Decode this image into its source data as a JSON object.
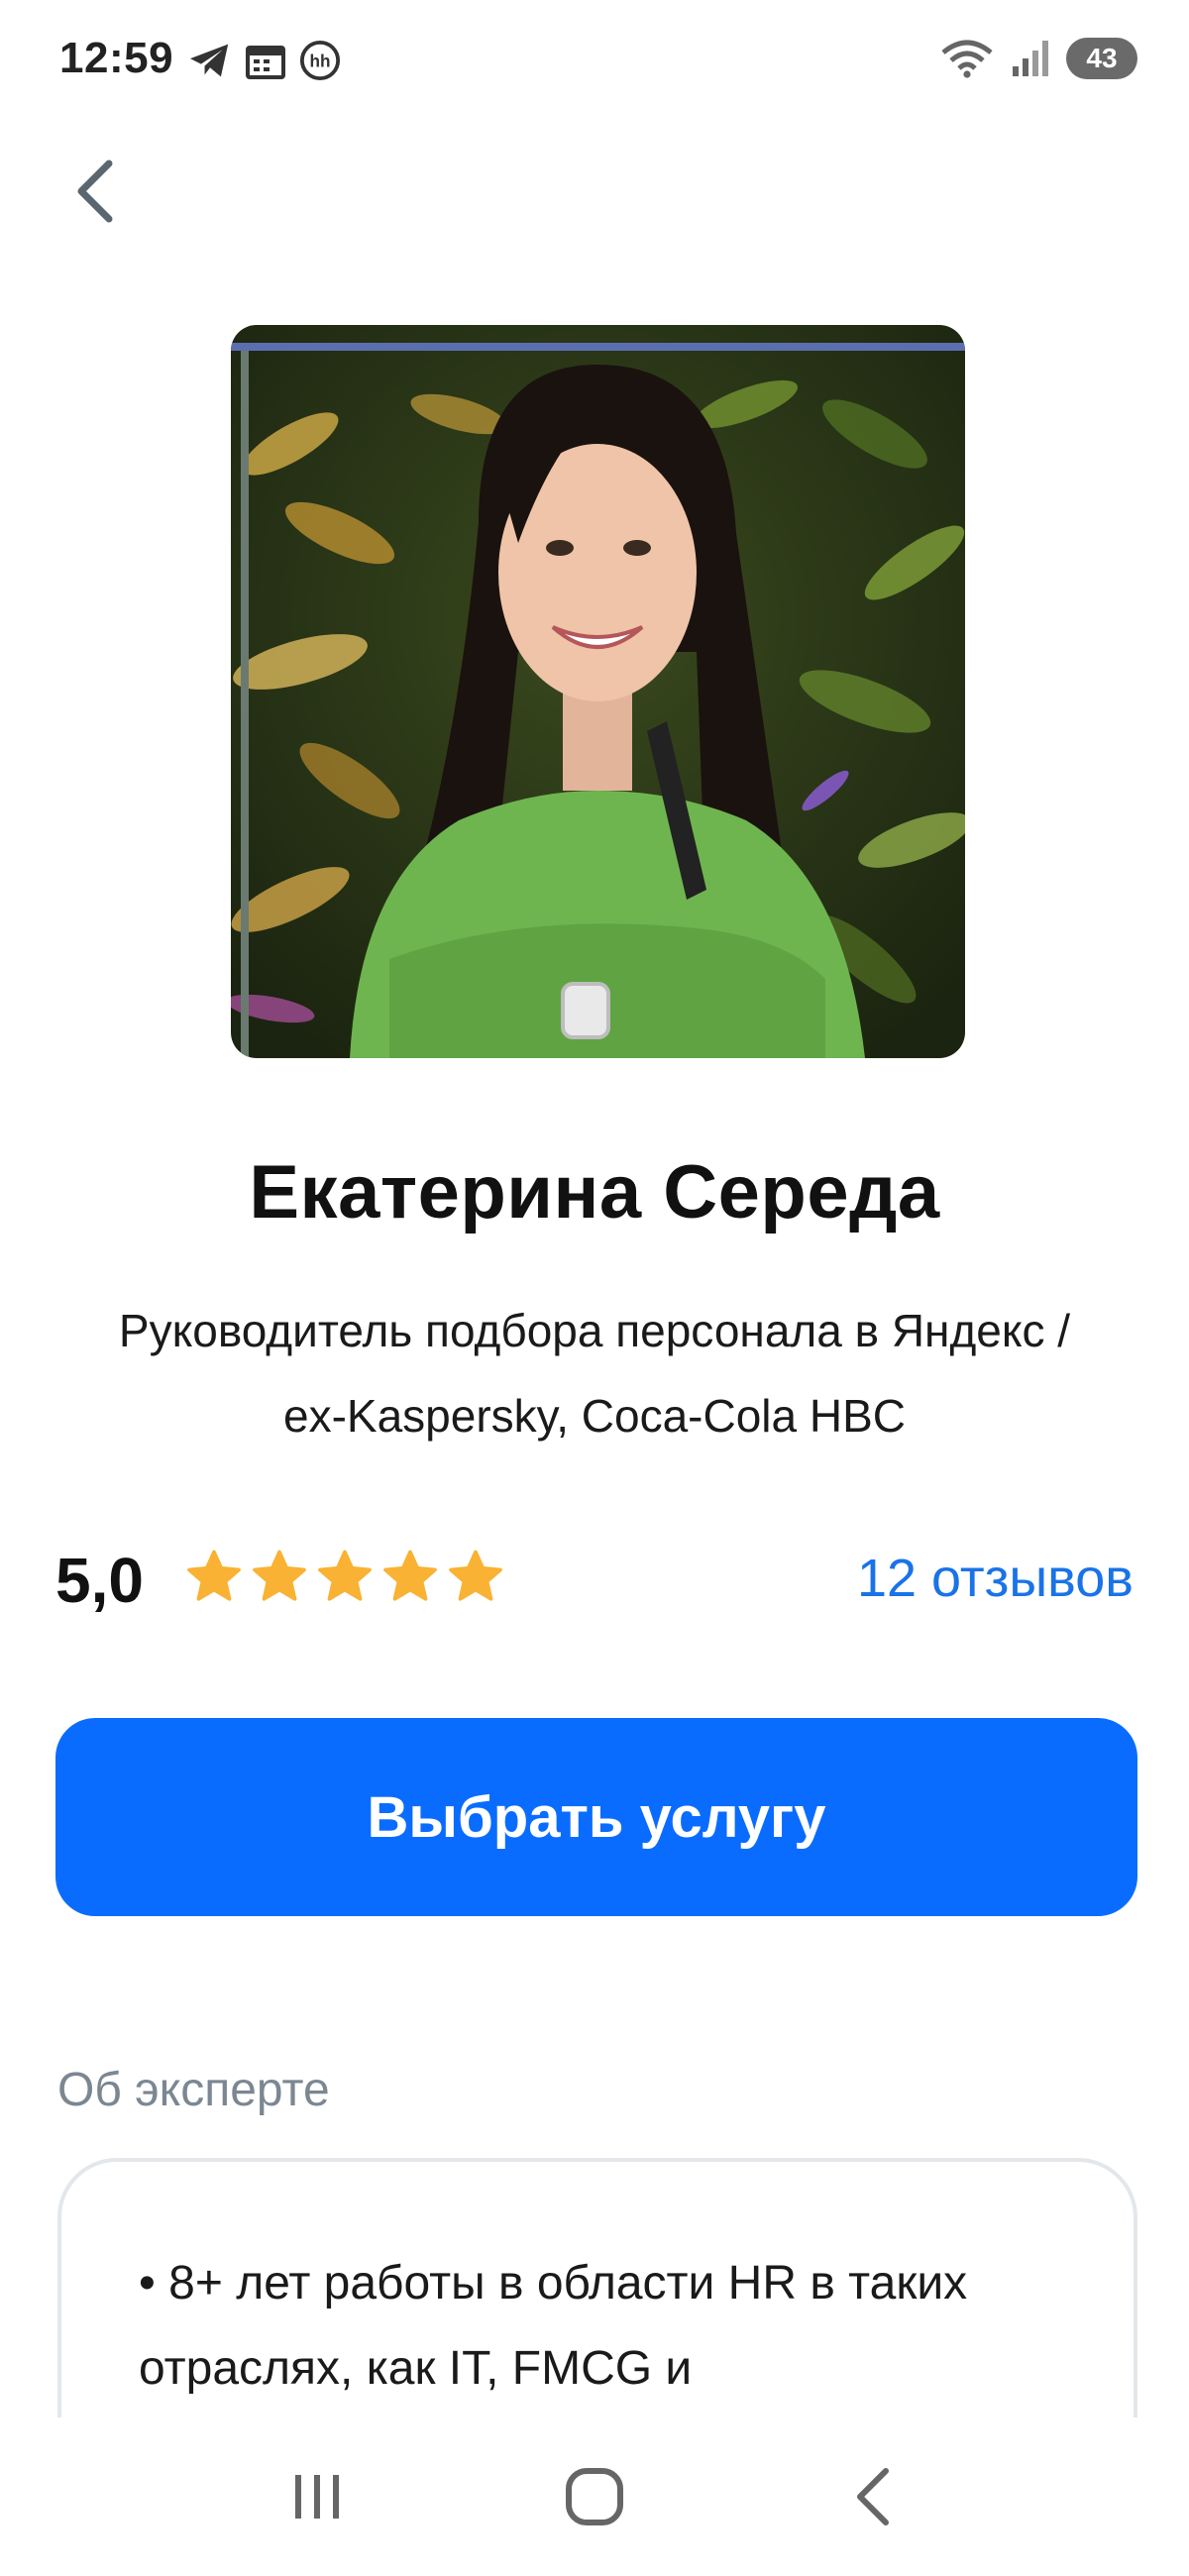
{
  "status_bar": {
    "time": "12:59",
    "battery": "43",
    "icons_left": [
      "telegram-icon",
      "calendar-icon",
      "hh-icon"
    ],
    "icons_right": [
      "wifi-icon",
      "signal-icon",
      "battery-icon"
    ]
  },
  "header": {
    "back_icon": "chevron-left-icon"
  },
  "profile": {
    "name": "Екатерина Середа",
    "subtitle": "Руководитель подбора персонала в Яндекс / ex-Kaspersky, Coca-Cola HBC",
    "rating": "5,0",
    "stars": 5,
    "star_color": "#f9b233",
    "reviews": "12 отзывов"
  },
  "cta": {
    "label": "Выбрать услугу",
    "color": "#0a6cff"
  },
  "about": {
    "title": "Об эксперте",
    "text": "• 8+ лет работы в области HR в таких отраслях, как IT, FMCG и"
  },
  "nav": {
    "items": [
      "recent-apps-icon",
      "home-icon",
      "back-icon"
    ]
  }
}
